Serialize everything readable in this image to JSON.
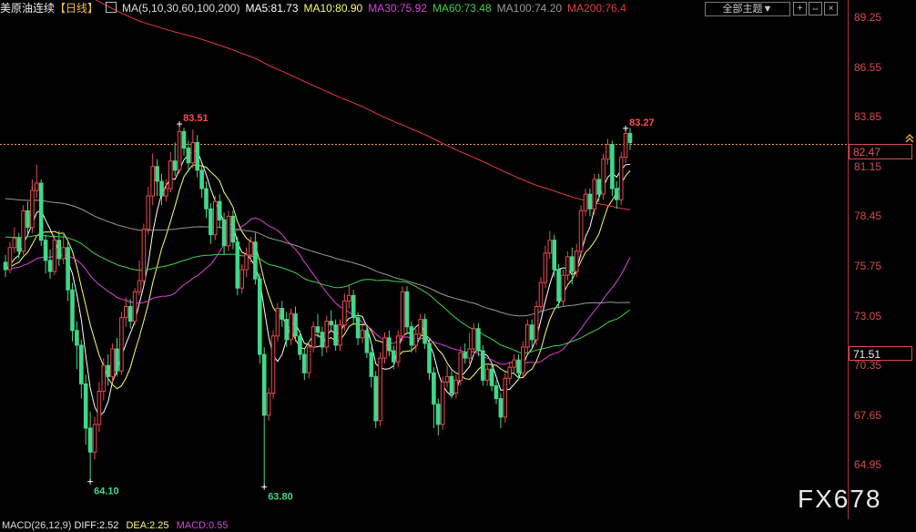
{
  "header": {
    "instrument": "美原油连续",
    "period": "【日线】",
    "ma_params": "MA(5,10,30,60,100,200)",
    "ma5": "MA5:81.73",
    "ma10": "MA10:80.90",
    "ma30": "MA30:75.92",
    "ma60": "MA60:73.48",
    "ma100": "MA100:74.20",
    "ma200": "MA200:76.4",
    "theme_button": "全部主题▼",
    "btn_plus": "+",
    "btn_fit": "⇔",
    "btn_close": "×"
  },
  "colors": {
    "up": "#e84b4b",
    "down": "#41d889",
    "ma5": "#ffffff",
    "ma10": "#ffff66",
    "ma30": "#e040e0",
    "ma60": "#3cd34d",
    "ma100": "#9a9a9a",
    "ma200": "#e43d3d"
  },
  "chart_data": {
    "type": "candlestick",
    "title": "美原油连续 日线",
    "y_ticks": [
      "89.25",
      "86.55",
      "83.85",
      "81.15",
      "78.45",
      "75.75",
      "73.05",
      "70.35",
      "67.65",
      "64.95"
    ],
    "ylim": [
      63.0,
      90.3
    ],
    "current_price": "82.47",
    "marker_price": "71.51",
    "annotations": [
      {
        "text": "83.51",
        "value": 83.51,
        "bar": 39
      },
      {
        "text": "64.10",
        "value": 64.1,
        "bar": 19
      },
      {
        "text": "63.80",
        "value": 63.8,
        "bar": 58
      },
      {
        "text": "83.27",
        "value": 83.27,
        "bar": 139
      }
    ],
    "candles": [
      [
        76.0,
        75.6,
        76.4,
        75.2
      ],
      [
        75.6,
        76.8,
        77.1,
        75.4
      ],
      [
        76.8,
        77.3,
        77.9,
        76.5
      ],
      [
        77.3,
        76.6,
        77.6,
        76.2
      ],
      [
        76.6,
        78.8,
        79.1,
        76.4
      ],
      [
        78.8,
        77.9,
        79.3,
        77.5
      ],
      [
        77.9,
        79.9,
        80.5,
        77.6
      ],
      [
        79.9,
        80.3,
        81.3,
        79.5
      ],
      [
        80.3,
        77.2,
        80.5,
        76.9
      ],
      [
        77.2,
        76.1,
        77.5,
        75.4
      ],
      [
        76.1,
        75.5,
        76.7,
        75.1
      ],
      [
        75.5,
        77.2,
        77.5,
        75.3
      ],
      [
        77.2,
        76.2,
        77.7,
        75.8
      ],
      [
        76.2,
        76.8,
        77.6,
        75.9
      ],
      [
        76.8,
        74.5,
        77.1,
        73.9
      ],
      [
        74.5,
        72.3,
        74.9,
        71.7
      ],
      [
        72.3,
        71.5,
        72.8,
        70.2
      ],
      [
        71.5,
        69.4,
        71.8,
        68.6
      ],
      [
        69.4,
        67.0,
        69.9,
        66.1
      ],
      [
        67.0,
        65.7,
        67.9,
        64.1
      ],
      [
        65.7,
        67.2,
        67.6,
        65.3
      ],
      [
        67.2,
        69.0,
        69.5,
        66.8
      ],
      [
        69.0,
        70.4,
        70.8,
        68.5
      ],
      [
        70.4,
        69.8,
        71.0,
        69.3
      ],
      [
        69.8,
        71.3,
        71.6,
        69.5
      ],
      [
        71.3,
        70.1,
        71.9,
        69.8
      ],
      [
        70.1,
        73.0,
        73.3,
        69.9
      ],
      [
        73.0,
        73.6,
        74.1,
        72.5
      ],
      [
        73.6,
        72.8,
        74.0,
        72.4
      ],
      [
        72.8,
        74.4,
        74.6,
        72.6
      ],
      [
        74.4,
        75.0,
        76.1,
        74.2
      ],
      [
        75.0,
        77.8,
        78.1,
        74.8
      ],
      [
        77.8,
        79.6,
        80.1,
        77.5
      ],
      [
        79.6,
        81.2,
        81.9,
        79.1
      ],
      [
        81.2,
        80.4,
        81.6,
        79.6
      ],
      [
        80.4,
        79.6,
        80.8,
        79.1
      ],
      [
        79.6,
        80.0,
        80.5,
        79.3
      ],
      [
        80.0,
        81.5,
        82.0,
        79.8
      ],
      [
        81.5,
        81.0,
        82.5,
        80.7
      ],
      [
        81.0,
        83.1,
        83.5,
        80.8
      ],
      [
        83.1,
        82.2,
        83.3,
        81.8
      ],
      [
        82.2,
        81.4,
        82.6,
        80.9
      ],
      [
        81.4,
        82.5,
        83.2,
        81.1
      ],
      [
        82.5,
        81.0,
        82.9,
        80.6
      ],
      [
        81.0,
        80.0,
        81.3,
        79.5
      ],
      [
        80.0,
        78.9,
        80.4,
        78.4
      ],
      [
        78.9,
        77.5,
        79.2,
        77.0
      ],
      [
        77.5,
        79.3,
        79.6,
        77.2
      ],
      [
        79.3,
        78.3,
        79.7,
        77.9
      ],
      [
        78.3,
        76.9,
        78.7,
        76.4
      ],
      [
        76.9,
        78.5,
        78.8,
        76.6
      ],
      [
        78.5,
        77.1,
        78.8,
        76.7
      ],
      [
        77.1,
        74.6,
        77.4,
        74.2
      ],
      [
        74.6,
        75.6,
        75.9,
        74.3
      ],
      [
        75.6,
        76.4,
        76.8,
        75.2
      ],
      [
        76.4,
        77.1,
        77.4,
        76.0
      ],
      [
        77.1,
        75.1,
        77.6,
        74.8
      ],
      [
        75.1,
        71.0,
        75.4,
        70.5
      ],
      [
        71.0,
        67.7,
        71.4,
        63.8
      ],
      [
        67.7,
        68.9,
        69.2,
        67.4
      ],
      [
        68.9,
        72.0,
        72.3,
        68.6
      ],
      [
        72.0,
        73.5,
        73.8,
        71.7
      ],
      [
        73.5,
        72.9,
        73.9,
        72.5
      ],
      [
        72.9,
        71.8,
        73.3,
        71.4
      ],
      [
        71.8,
        73.2,
        73.5,
        71.5
      ],
      [
        73.2,
        72.0,
        73.6,
        71.7
      ],
      [
        72.0,
        71.0,
        72.3,
        70.7
      ],
      [
        71.0,
        70.0,
        71.3,
        69.6
      ],
      [
        70.0,
        71.4,
        71.7,
        69.7
      ],
      [
        71.4,
        72.5,
        72.8,
        71.1
      ],
      [
        72.5,
        72.2,
        73.2,
        71.9
      ],
      [
        72.2,
        71.4,
        72.5,
        70.9
      ],
      [
        71.4,
        72.8,
        73.1,
        71.1
      ],
      [
        72.8,
        72.6,
        73.4,
        72.3
      ],
      [
        72.6,
        71.5,
        72.9,
        71.2
      ],
      [
        71.5,
        72.6,
        72.9,
        71.2
      ],
      [
        72.6,
        73.9,
        74.3,
        72.3
      ],
      [
        73.9,
        74.2,
        74.8,
        73.5
      ],
      [
        74.2,
        73.0,
        74.5,
        72.6
      ],
      [
        73.0,
        71.9,
        73.3,
        71.5
      ],
      [
        71.9,
        72.3,
        72.6,
        71.6
      ],
      [
        72.3,
        71.1,
        72.6,
        70.8
      ],
      [
        71.1,
        69.8,
        71.4,
        69.2
      ],
      [
        69.8,
        67.4,
        70.1,
        67.0
      ],
      [
        67.4,
        70.8,
        71.1,
        67.1
      ],
      [
        70.8,
        71.9,
        72.2,
        70.5
      ],
      [
        71.9,
        71.2,
        72.3,
        70.9
      ],
      [
        71.2,
        70.6,
        71.5,
        70.2
      ],
      [
        70.6,
        72.0,
        72.3,
        70.3
      ],
      [
        72.0,
        74.4,
        74.7,
        71.7
      ],
      [
        74.4,
        72.5,
        74.7,
        72.1
      ],
      [
        72.5,
        71.5,
        72.8,
        71.1
      ],
      [
        71.5,
        72.1,
        72.4,
        71.1
      ],
      [
        72.1,
        72.9,
        73.2,
        71.8
      ],
      [
        72.9,
        71.6,
        73.2,
        71.3
      ],
      [
        71.6,
        70.0,
        71.9,
        69.6
      ],
      [
        70.0,
        68.3,
        70.3,
        67.0
      ],
      [
        68.3,
        67.2,
        68.6,
        66.6
      ],
      [
        67.2,
        69.5,
        69.8,
        66.9
      ],
      [
        69.5,
        69.8,
        70.4,
        69.2
      ],
      [
        69.8,
        68.9,
        70.1,
        68.6
      ],
      [
        68.9,
        69.6,
        69.9,
        68.6
      ],
      [
        69.6,
        71.1,
        71.4,
        69.3
      ],
      [
        71.1,
        70.8,
        71.6,
        70.5
      ],
      [
        70.8,
        71.3,
        72.2,
        70.5
      ],
      [
        71.3,
        72.4,
        72.7,
        71.0
      ],
      [
        72.4,
        71.2,
        72.7,
        70.9
      ],
      [
        71.2,
        69.6,
        71.5,
        69.3
      ],
      [
        69.6,
        70.2,
        70.5,
        69.3
      ],
      [
        70.2,
        69.3,
        70.5,
        69.0
      ],
      [
        69.3,
        68.6,
        69.6,
        68.3
      ],
      [
        68.6,
        67.6,
        68.9,
        67.0
      ],
      [
        67.6,
        69.7,
        70.0,
        67.3
      ],
      [
        69.7,
        70.3,
        70.6,
        69.4
      ],
      [
        70.3,
        70.7,
        71.0,
        70.0
      ],
      [
        70.7,
        70.0,
        71.0,
        69.6
      ],
      [
        70.0,
        71.4,
        71.7,
        69.8
      ],
      [
        71.4,
        72.6,
        72.9,
        71.1
      ],
      [
        72.6,
        71.8,
        72.9,
        71.4
      ],
      [
        71.8,
        73.6,
        73.9,
        71.5
      ],
      [
        73.6,
        74.9,
        75.2,
        73.3
      ],
      [
        74.9,
        76.5,
        76.9,
        74.6
      ],
      [
        76.5,
        77.2,
        77.7,
        76.2
      ],
      [
        77.2,
        75.6,
        77.5,
        75.2
      ],
      [
        75.6,
        73.9,
        75.9,
        73.5
      ],
      [
        73.9,
        75.3,
        75.6,
        73.6
      ],
      [
        75.3,
        76.3,
        76.6,
        75.0
      ],
      [
        76.3,
        75.5,
        76.8,
        74.8
      ],
      [
        75.5,
        76.6,
        77.0,
        75.2
      ],
      [
        76.6,
        78.8,
        79.1,
        76.3
      ],
      [
        78.8,
        79.7,
        80.0,
        78.5
      ],
      [
        79.7,
        78.9,
        80.0,
        78.5
      ],
      [
        78.9,
        80.5,
        80.8,
        78.6
      ],
      [
        80.5,
        79.7,
        80.8,
        79.3
      ],
      [
        79.7,
        81.6,
        81.9,
        79.4
      ],
      [
        81.6,
        82.4,
        82.7,
        81.3
      ],
      [
        82.4,
        80.0,
        82.6,
        79.6
      ],
      [
        80.0,
        79.4,
        80.4,
        78.9
      ],
      [
        79.4,
        81.7,
        82.0,
        79.1
      ],
      [
        81.7,
        83.0,
        83.3,
        81.4
      ],
      [
        83.0,
        82.5,
        83.3,
        82.1
      ]
    ]
  },
  "macd": {
    "label": "MACD(26,12,9)",
    "dif": "DIFF:2.52",
    "dea": "DEA:2.25",
    "macd": "MACD:0.55"
  },
  "watermark": "FX678"
}
